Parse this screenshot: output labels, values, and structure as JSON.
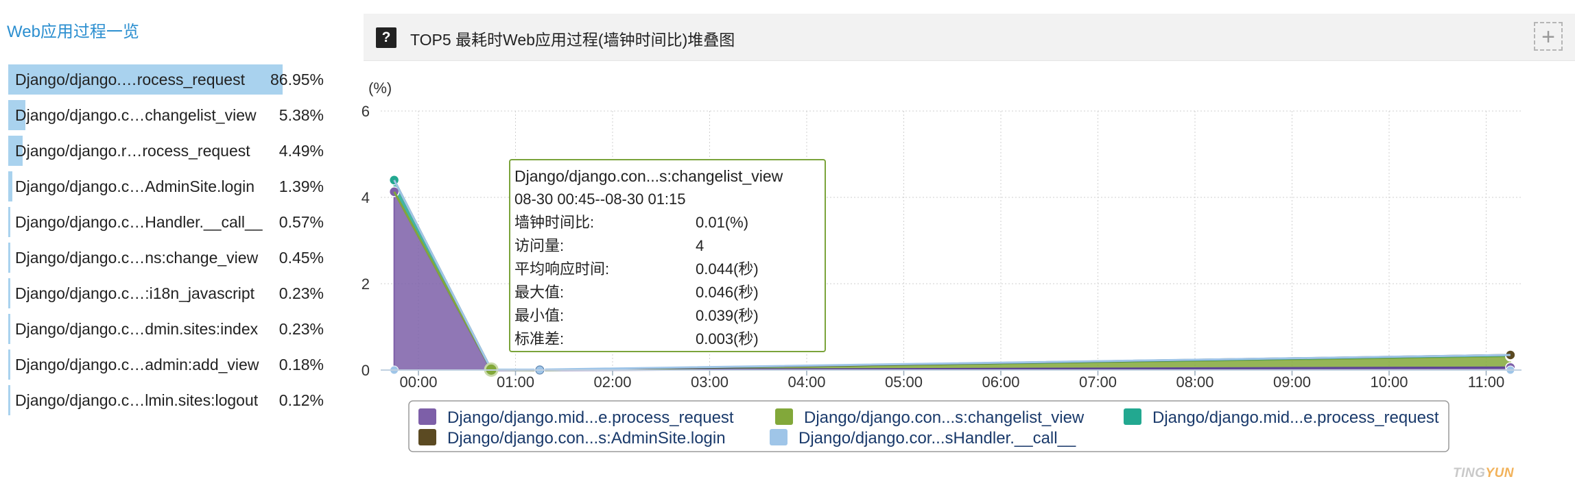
{
  "left": {
    "title": "Web应用过程一览",
    "items": [
      {
        "label": "Django/django.…rocess_request",
        "value": "86.95%",
        "pct": 86.95
      },
      {
        "label": "Django/django.c…changelist_view",
        "value": "5.38%",
        "pct": 5.38
      },
      {
        "label": "Django/django.r…rocess_request",
        "value": "4.49%",
        "pct": 4.49
      },
      {
        "label": "Django/django.c…AdminSite.login",
        "value": "1.39%",
        "pct": 1.39
      },
      {
        "label": "Django/django.c…Handler.__call__",
        "value": "0.57%",
        "pct": 0.57
      },
      {
        "label": "Django/django.c…ns:change_view",
        "value": "0.45%",
        "pct": 0.45
      },
      {
        "label": "Django/django.c…:i18n_javascript",
        "value": "0.23%",
        "pct": 0.23
      },
      {
        "label": "Django/django.c…dmin.sites:index",
        "value": "0.23%",
        "pct": 0.23
      },
      {
        "label": "Django/django.c…admin:add_view",
        "value": "0.18%",
        "pct": 0.18
      },
      {
        "label": "Django/django.c…lmin.sites:logout",
        "value": "0.12%",
        "pct": 0.12
      }
    ]
  },
  "panel": {
    "help_icon": "?",
    "title": "TOP5 最耗时Web应用过程(墙钟时间比)堆叠图",
    "expand_icon": "+"
  },
  "tooltip": {
    "title": "Django/django.con...s:changelist_view",
    "range": "08-30 00:45--08-30 01:15",
    "rows": [
      {
        "key": "墙钟时间比:",
        "value": "0.01(%)"
      },
      {
        "key": "访问量:",
        "value": "4"
      },
      {
        "key": "平均响应时间:",
        "value": "0.044(秒)"
      },
      {
        "key": "最大值:",
        "value": "0.046(秒)"
      },
      {
        "key": "最小值:",
        "value": "0.039(秒)"
      },
      {
        "key": "标准差:",
        "value": "0.003(秒)"
      }
    ]
  },
  "brand": {
    "part1": "TING",
    "part2": "YUN"
  },
  "chart_data": {
    "type": "area",
    "stacked": true,
    "y_unit_label": "(%)",
    "ylim": [
      0,
      6
    ],
    "y_ticks": [
      0,
      2,
      4,
      6
    ],
    "x_ticks": [
      "00:00",
      "01:00",
      "02:00",
      "03:00",
      "04:00",
      "05:00",
      "06:00",
      "07:00",
      "08:00",
      "09:00",
      "10:00",
      "11:00"
    ],
    "grid": true,
    "legend_position": "bottom",
    "x": [
      -0.25,
      0.75,
      1.25,
      11.25
    ],
    "series": [
      {
        "name": "Django/django.mid...e.process_request",
        "color": "#7d5fa8",
        "values": [
          4.13,
          0.0,
          0.0,
          0.06
        ]
      },
      {
        "name": "Django/django.con...s:changelist_view",
        "color": "#82a83a",
        "values": [
          0.0,
          0.01,
          0.0,
          0.26
        ]
      },
      {
        "name": "Django/django.mid...e.process_request",
        "color": "#22a890",
        "values": [
          0.27,
          0.0,
          0.0,
          0.02
        ]
      },
      {
        "name": "Django/django.con...s:AdminSite.login",
        "color": "#5b4a22",
        "values": [
          0.0,
          0.0,
          0.0,
          0.01
        ]
      },
      {
        "name": "Django/django.cor...sHandler.__call__",
        "color": "#9fc5e8",
        "values": [
          0.0,
          0.0,
          0.01,
          0.0
        ]
      }
    ]
  }
}
